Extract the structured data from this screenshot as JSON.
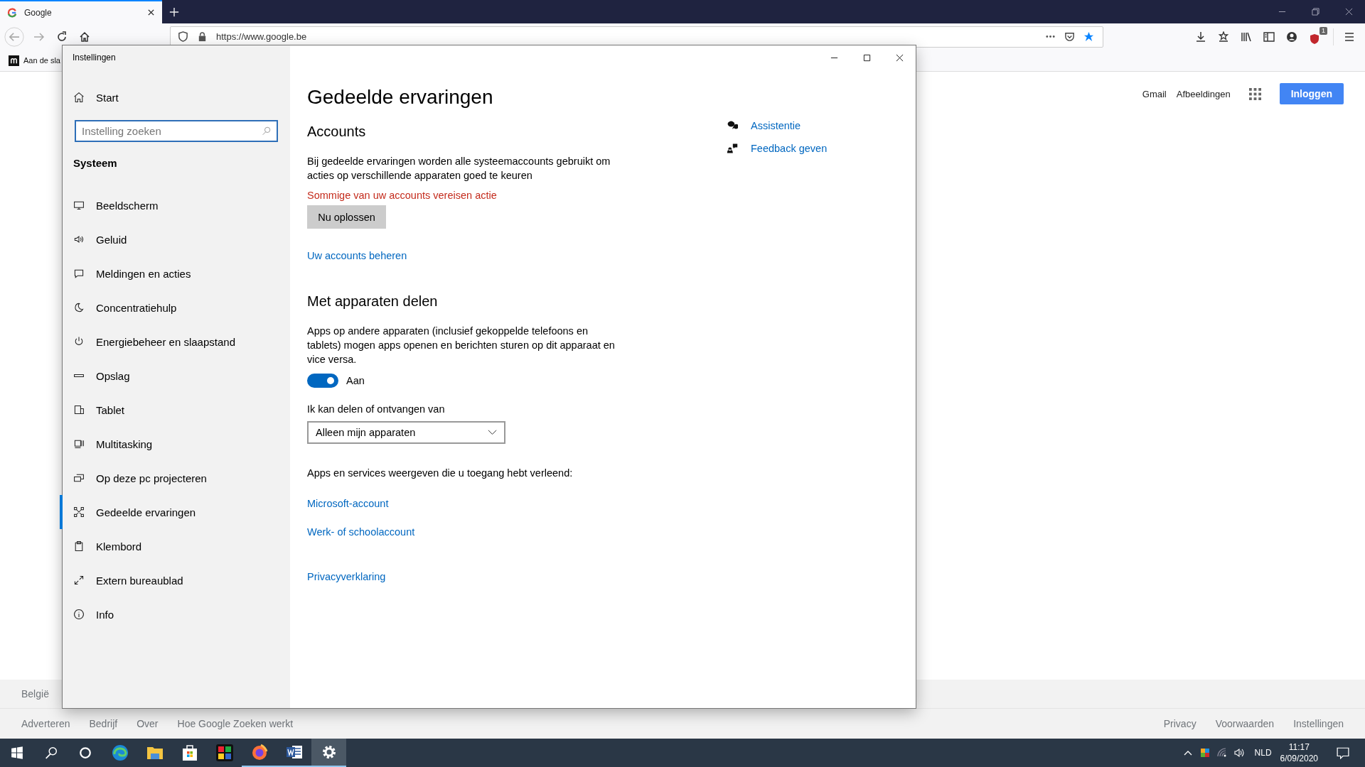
{
  "browser": {
    "tabs": [
      {
        "label": "Google",
        "selected": true
      }
    ],
    "url": "https://www.google.be",
    "bookmarks": [
      {
        "label": "Aan de sla"
      }
    ],
    "extension_badge": "1"
  },
  "google": {
    "header_links": [
      "Gmail",
      "Afbeeldingen"
    ],
    "sign_in": "Inloggen",
    "country": "België",
    "footer_left": [
      "Adverteren",
      "Bedrijf",
      "Over",
      "Hoe Google Zoeken werkt"
    ],
    "footer_right": [
      "Privacy",
      "Voorwaarden",
      "Instellingen"
    ]
  },
  "settings": {
    "title": "Instellingen",
    "home": "Start",
    "search": {
      "placeholder": "Instelling zoeken"
    },
    "section": "Systeem",
    "nav": [
      {
        "label": "Beeldscherm",
        "kind": "display",
        "selected": false
      },
      {
        "label": "Geluid",
        "kind": "sound",
        "selected": false
      },
      {
        "label": "Meldingen en acties",
        "kind": "notifications",
        "selected": false
      },
      {
        "label": "Concentratiehulp",
        "kind": "focus",
        "selected": false
      },
      {
        "label": "Energiebeheer en slaapstand",
        "kind": "power",
        "selected": false
      },
      {
        "label": "Opslag",
        "kind": "storage",
        "selected": false
      },
      {
        "label": "Tablet",
        "kind": "tablet",
        "selected": false
      },
      {
        "label": "Multitasking",
        "kind": "multitask",
        "selected": false
      },
      {
        "label": "Op deze pc projecteren",
        "kind": "project",
        "selected": false
      },
      {
        "label": "Gedeelde ervaringen",
        "kind": "shared",
        "selected": true
      },
      {
        "label": "Klembord",
        "kind": "clipboard",
        "selected": false
      },
      {
        "label": "Extern bureaublad",
        "kind": "remote",
        "selected": false
      },
      {
        "label": "Info",
        "kind": "about",
        "selected": false
      }
    ],
    "page_title": "Gedeelde ervaringen",
    "accounts": {
      "heading": "Accounts",
      "text": "Bij gedeelde ervaringen worden alle systeemaccounts gebruikt om acties op verschillende apparaten goed te keuren",
      "warning": "Sommige van uw accounts vereisen actie",
      "fix_button": "Nu oplossen",
      "manage_link": "Uw accounts beheren"
    },
    "sharing": {
      "heading": "Met apparaten delen",
      "text": "Apps op andere apparaten (inclusief gekoppelde telefoons en tablets) mogen apps openen en berichten sturen op dit apparaat en vice versa.",
      "toggle": {
        "on": true,
        "label": "Aan"
      },
      "dropdown": {
        "label": "Ik kan delen of ontvangen van",
        "value": "Alleen mijn apparaten"
      }
    },
    "apps_text": "Apps en services weergeven die u toegang hebt verleend:",
    "account_links": [
      "Microsoft-account",
      "Werk- of schoolaccount"
    ],
    "privacy_link": "Privacyverklaring",
    "related": [
      {
        "label": "Assistentie",
        "kind": "help"
      },
      {
        "label": "Feedback geven",
        "kind": "feedback"
      }
    ]
  },
  "taskbar": {
    "apps": [
      {
        "kind": "edge",
        "running": false,
        "selected": false
      },
      {
        "kind": "explorer",
        "running": false,
        "selected": false
      },
      {
        "kind": "store",
        "running": false,
        "selected": false
      },
      {
        "kind": "puzzle",
        "running": false,
        "selected": false
      },
      {
        "kind": "firefox",
        "running": true,
        "selected": false
      },
      {
        "kind": "word",
        "running": true,
        "selected": false
      },
      {
        "kind": "settings",
        "running": true,
        "selected": true
      }
    ],
    "language": "NLD",
    "time": "11:17",
    "date": "6/09/2020"
  }
}
